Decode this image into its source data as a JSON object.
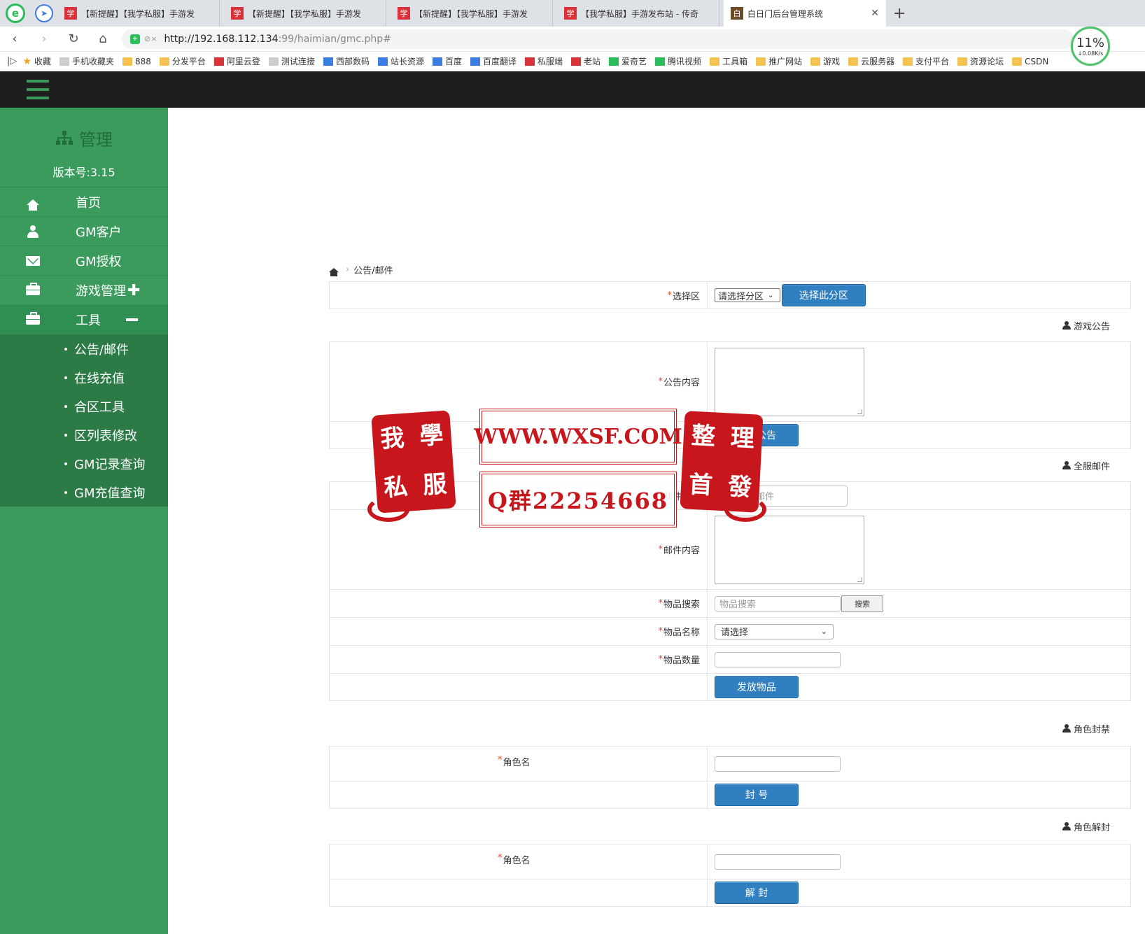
{
  "browser": {
    "tabs": [
      {
        "title": "【新提醒】【我学私服】手游发",
        "icon": "site-favicon",
        "active": false
      },
      {
        "title": "【新提醒】【我学私服】手游发",
        "icon": "site-favicon",
        "active": false
      },
      {
        "title": "【新提醒】【我学私服】手游发",
        "icon": "site-favicon",
        "active": false
      },
      {
        "title": "【我学私服】手游发布站 - 传奇",
        "icon": "site-favicon",
        "active": false
      },
      {
        "title": "白日门后台管理系统",
        "icon": "admin-favicon",
        "active": true
      }
    ],
    "url_host": "http://192.168.112.134",
    "url_path": ":99/haimian/gmc.php#",
    "speed_percent": "11%",
    "speed_rate": "↓0.08K/s",
    "bookmarks": [
      {
        "label": "收藏",
        "icon": "star"
      },
      {
        "label": "手机收藏夹",
        "icon": "gray"
      },
      {
        "label": "888",
        "icon": "folder"
      },
      {
        "label": "分发平台",
        "icon": "folder"
      },
      {
        "label": "阿里云登",
        "icon": "site"
      },
      {
        "label": "测试连接",
        "icon": "gray"
      },
      {
        "label": "西部数码",
        "icon": "blue"
      },
      {
        "label": "站长资源",
        "icon": "blue"
      },
      {
        "label": "百度",
        "icon": "blue"
      },
      {
        "label": "百度翻译",
        "icon": "blue"
      },
      {
        "label": "私服端",
        "icon": "site"
      },
      {
        "label": "老站",
        "icon": "site"
      },
      {
        "label": "爱奇艺",
        "icon": "green"
      },
      {
        "label": "腾讯视频",
        "icon": "green"
      },
      {
        "label": "工具箱",
        "icon": "folder"
      },
      {
        "label": "推广网站",
        "icon": "folder"
      },
      {
        "label": "游戏",
        "icon": "folder"
      },
      {
        "label": "云服务器",
        "icon": "folder"
      },
      {
        "label": "支付平台",
        "icon": "folder"
      },
      {
        "label": "资源论坛",
        "icon": "folder"
      },
      {
        "label": "CSDN",
        "icon": "folder"
      }
    ]
  },
  "sidebar": {
    "title": "管理",
    "version": "版本号:3.15",
    "items": [
      {
        "label": "首页",
        "icon": "home-icon"
      },
      {
        "label": "GM客户",
        "icon": "user-icon"
      },
      {
        "label": "GM授权",
        "icon": "envelope-icon"
      },
      {
        "label": "游戏管理",
        "icon": "briefcase-icon",
        "suffix": "✚"
      },
      {
        "label": "工具",
        "icon": "briefcase-icon",
        "open": true
      }
    ],
    "submenu": [
      "公告/邮件",
      "在线充值",
      "合区工具",
      "区列表修改",
      "GM记录查询",
      "GM充值查询"
    ]
  },
  "breadcrumb": {
    "current": "公告/邮件"
  },
  "zone": {
    "label": "选择区",
    "select_value": "请选择分区",
    "button": "选择此分区"
  },
  "announcement": {
    "section": "游戏公告",
    "content_label": "公告内容",
    "button": "发送公告"
  },
  "server_mail": {
    "section": "全服邮件",
    "title_label": "邮件标题",
    "title_placeholder": "填写全服邮件",
    "content_label": "邮件内容",
    "item_search_label": "物品搜索",
    "item_search_placeholder": "物品搜索",
    "search_button": "搜索",
    "item_name_label": "物品名称",
    "item_name_value": "请选择",
    "item_qty_label": "物品数量",
    "send_button": "发放物品"
  },
  "ban": {
    "section": "角色封禁",
    "role_label": "角色名",
    "button": "封 号"
  },
  "unban": {
    "section": "角色解封",
    "role_label": "角色名",
    "button": "解 封"
  },
  "watermark": {
    "banner_top": "WWW.WXSF.COM",
    "banner_bottom": "Q群22254668",
    "seal_left": [
      "我",
      "學",
      "私",
      "服"
    ],
    "seal_right": [
      "整",
      "理",
      "首",
      "發"
    ]
  },
  "colors": {
    "sidebar": "#3a9b5c",
    "submenu": "#2c7b47",
    "topbar": "#1e1e1e",
    "primary_button": "#2f7fc1",
    "required": "#e04b2d",
    "watermark": "#c7171d"
  }
}
